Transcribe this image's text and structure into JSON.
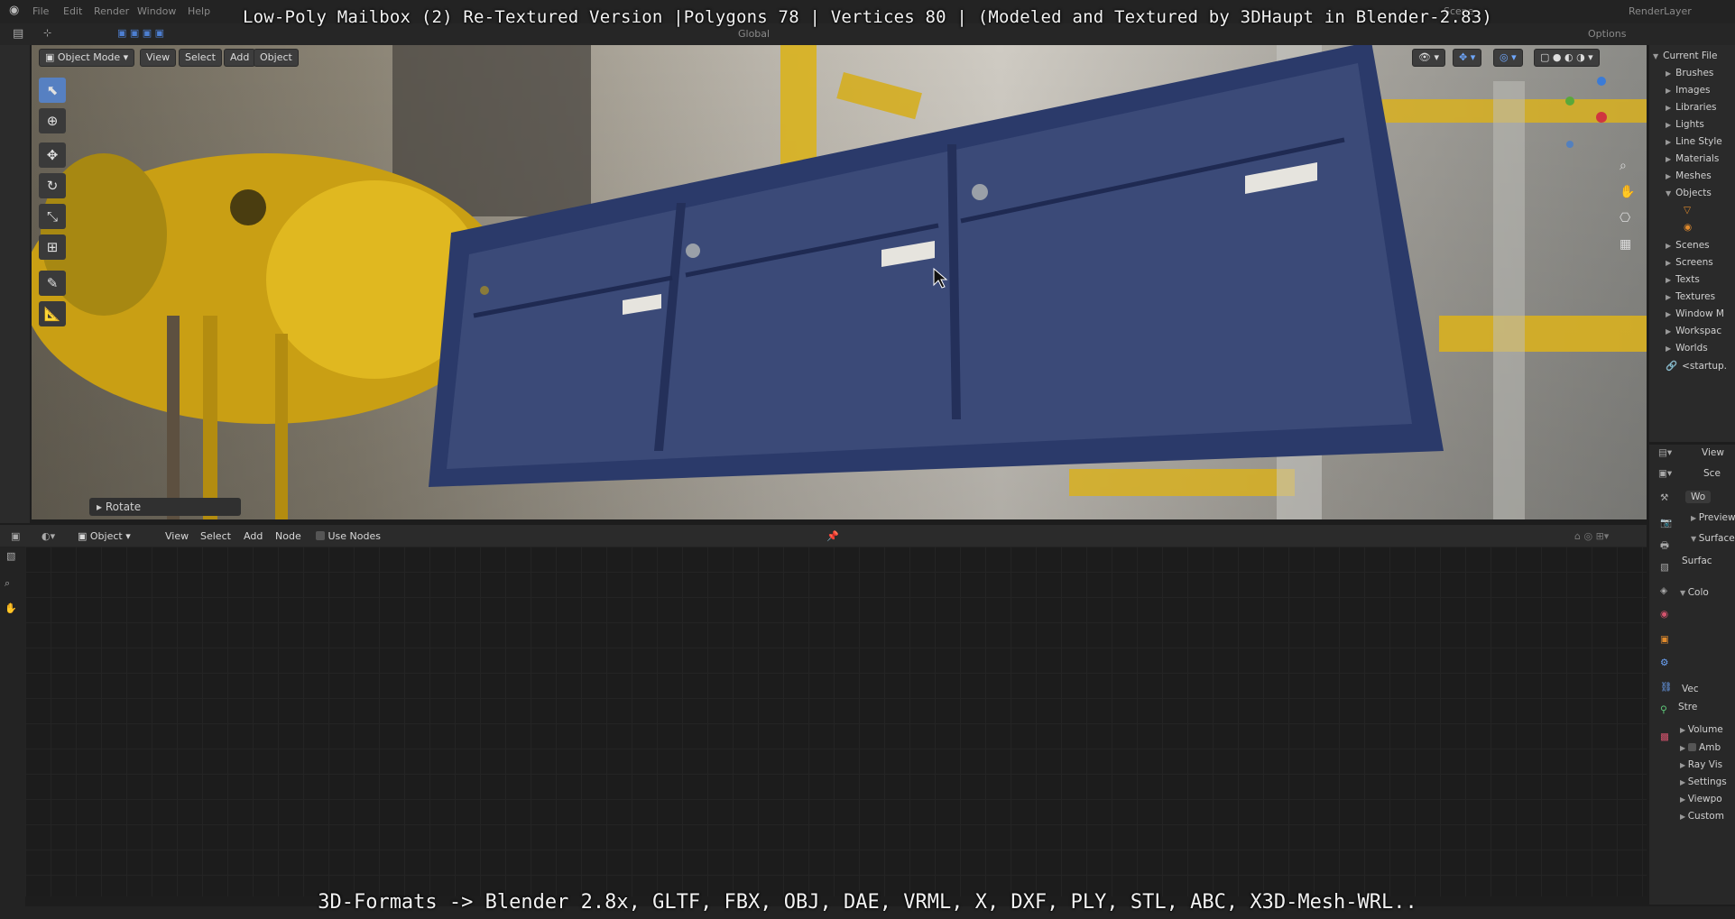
{
  "captions": {
    "top": "Low-Poly Mailbox (2) Re-Textured Version |Polygons 78 | Vertices 80 | (Modeled and Textured by 3DHaupt in Blender-2.83)",
    "bottom": "3D-Formats -> Blender 2.8x, GLTF, FBX, OBJ, DAE, VRML, X, DXF, PLY, STL, ABC, X3D-Mesh-WRL.."
  },
  "menu": [
    "File",
    "Edit",
    "Render",
    "Window",
    "Help"
  ],
  "scene_label": "Scene",
  "renderlayer_label": "RenderLayer",
  "viewport": {
    "mode_label": "Object Mode",
    "view_menu": "View",
    "select_menu": "Select",
    "add_menu": "Add",
    "object_menu": "Object",
    "transform_label": "Global",
    "options_label": "Options",
    "operator_panel_label": "Rotate"
  },
  "node_editor": {
    "object_label": "Object",
    "view_menu": "View",
    "select_menu": "Select",
    "add_menu": "Add",
    "node_menu": "Node",
    "use_nodes_label": "Use Nodes"
  },
  "outliner": {
    "root": "Current File",
    "items": [
      "Brushes",
      "Images",
      "Libraries",
      "Lights",
      "Line Style",
      "Materials",
      "Meshes",
      "Objects",
      "Scenes",
      "Screens",
      "Texts",
      "Textures",
      "Window M",
      "Workspac",
      "Worlds",
      "<startup."
    ]
  },
  "properties": {
    "view_label": "View",
    "scene_tab": "Sce",
    "world_field": "Wo",
    "sections": [
      "Preview",
      "Surface"
    ],
    "surface_label": "Surfac",
    "color_label": "Colo",
    "vec_label": "Vec",
    "strength_label": "Stre",
    "more_sections": [
      "Volume",
      "Amb",
      "Ray Vis",
      "Settings",
      "Viewpo",
      "Custom"
    ]
  },
  "colors": {
    "mailbox_blue": "#3b4a78",
    "pipe_yellow": "#d9b21e",
    "ui_dark": "#232323"
  }
}
